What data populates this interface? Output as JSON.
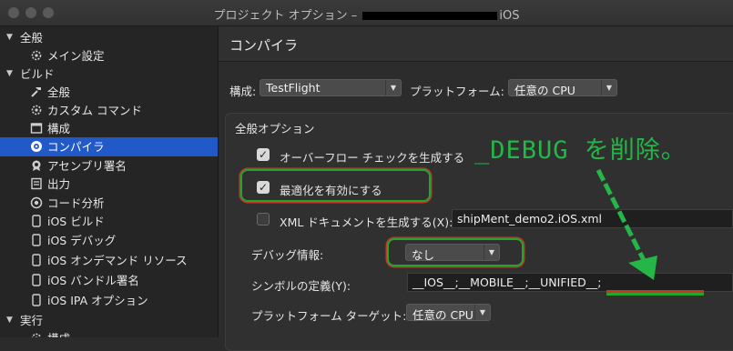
{
  "window": {
    "title_prefix": "プロジェクト オプション – ",
    "title_suffix": "iOS"
  },
  "sidebar": {
    "sections": [
      {
        "label": "全般",
        "items": [
          {
            "label": "メイン設定",
            "icon": "gear-icon"
          }
        ]
      },
      {
        "label": "ビルド",
        "items": [
          {
            "label": "全般",
            "icon": "hammer-icon"
          },
          {
            "label": "カスタム コマンド",
            "icon": "gear-icon"
          },
          {
            "label": "構成",
            "icon": "window-icon"
          },
          {
            "label": "コンパイラ",
            "icon": "compiler-icon",
            "selected": true
          },
          {
            "label": "アセンブリ署名",
            "icon": "seal-icon"
          },
          {
            "label": "出力",
            "icon": "output-icon"
          },
          {
            "label": "コード分析",
            "icon": "analysis-icon"
          },
          {
            "label": "iOS ビルド",
            "icon": "phone-icon"
          },
          {
            "label": "iOS デバッグ",
            "icon": "phone-icon"
          },
          {
            "label": "iOS オンデマンド リソース",
            "icon": "phone-icon"
          },
          {
            "label": "iOS バンドル署名",
            "icon": "phone-icon"
          },
          {
            "label": "iOS IPA オプション",
            "icon": "phone-icon"
          }
        ]
      },
      {
        "label": "実行",
        "items": [
          {
            "label": "構成",
            "icon": "gear-icon"
          }
        ]
      }
    ]
  },
  "main": {
    "title": "コンパイラ",
    "config_label": "構成:",
    "config_value": "TestFlight",
    "platform_label": "プラットフォーム:",
    "platform_value": "任意の CPU",
    "group_title": "全般オプション",
    "overflow_label": "オーバーフロー チェックを生成する",
    "optimize_label": "最適化を有効にする",
    "xml_label": "XML ドキュメントを生成する(X):",
    "xml_value": "shipMent_demo2.iOS.xml",
    "debug_label": "デバッグ情報:",
    "debug_value": "なし",
    "symbols_label": "シンボルの定義(Y):",
    "symbols_value": "__IOS__;__MOBILE__;__UNIFIED__;",
    "target_label": "プラットフォーム ターゲット:",
    "target_value": "任意の CPU"
  },
  "annotation": {
    "text": "_DEBUG を削除。",
    "color": "#25b548"
  },
  "colors": {
    "accent": "#2159c8",
    "highlight_green": "#26a52c",
    "highlight_red": "#c0392b"
  }
}
